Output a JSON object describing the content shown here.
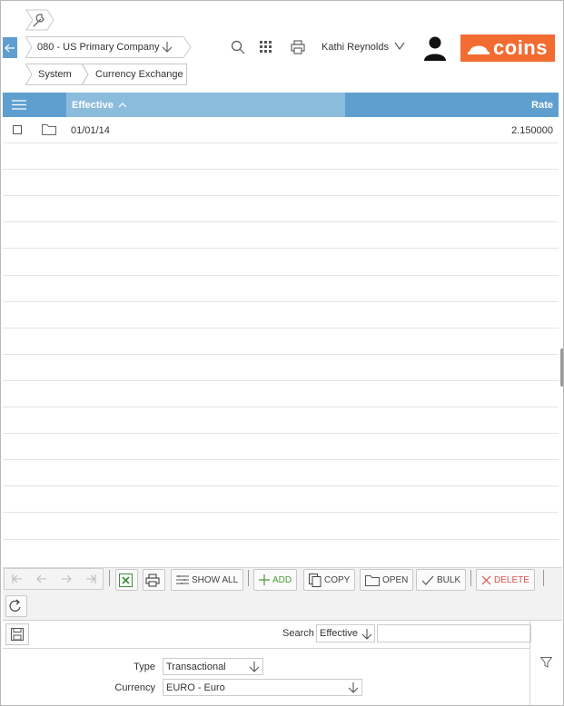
{
  "header": {
    "company": "080 - US Primary Company",
    "breadcrumb": [
      "System",
      "Currency Exchange"
    ],
    "user_name": "Kathi Reynolds",
    "logo_text": "coins",
    "brand_color": "#f26c32",
    "accent_color": "#5f9fcf"
  },
  "table": {
    "columns": {
      "effective": "Effective",
      "rate": "Rate"
    },
    "rows": [
      {
        "effective": "01/01/14",
        "rate": "2.150000"
      }
    ]
  },
  "toolbar": {
    "show_all": "SHOW ALL",
    "add": "ADD",
    "copy": "COPY",
    "open": "OPEN",
    "bulk": "BULK",
    "delete": "DELETE"
  },
  "search": {
    "label": "Search",
    "field": "Effective",
    "value": ""
  },
  "filters": {
    "type_label": "Type",
    "type_value": "Transactional",
    "currency_label": "Currency",
    "currency_value": "EURO - Euro"
  },
  "icons": [
    "wrench-icon",
    "back-arrow-icon",
    "search-icon",
    "grid-icon",
    "print-icon",
    "avatar",
    "menu-icon",
    "folder-icon",
    "first-icon",
    "prev-icon",
    "next-icon",
    "last-icon",
    "excel-icon",
    "refresh-icon",
    "save-icon",
    "filter-icon"
  ]
}
